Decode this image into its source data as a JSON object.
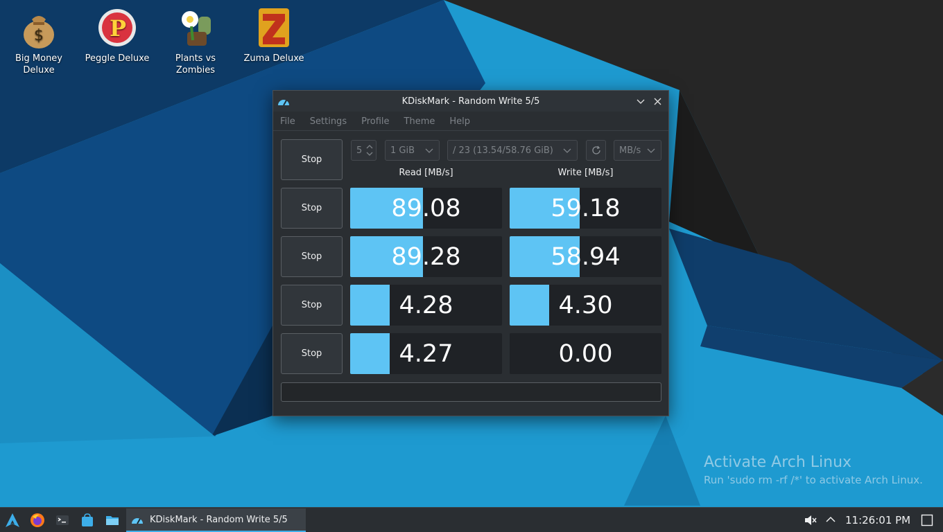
{
  "desktop": {
    "icons": [
      {
        "label": "Big Money\nDeluxe",
        "icon": "money-bag-icon"
      },
      {
        "label": "Peggle Deluxe",
        "icon": "peggle-icon"
      },
      {
        "label": "Plants vs\nZombies",
        "icon": "plants-vs-zombies-icon"
      },
      {
        "label": "Zuma Deluxe",
        "icon": "zuma-icon"
      }
    ],
    "watermark": {
      "title": "Activate Arch Linux",
      "subtitle": "Run 'sudo rm -rf /*' to activate Arch Linux."
    }
  },
  "window": {
    "title": "KDiskMark - Random Write 5/5",
    "menu": [
      "File",
      "Settings",
      "Profile",
      "Theme",
      "Help"
    ],
    "controls": {
      "runs": "5",
      "size": "1 GiB",
      "drive": "/ 23 (13.54/58.76 GiB)",
      "unit": "MB/s"
    },
    "headers": {
      "read": "Read [MB/s]",
      "write": "Write [MB/s]"
    },
    "all_button": "Stop",
    "rows": [
      {
        "button": "Stop",
        "read": "89.08",
        "write": "59.18",
        "read_fill": 0.48,
        "write_fill": 0.46
      },
      {
        "button": "Stop",
        "read": "89.28",
        "write": "58.94",
        "read_fill": 0.48,
        "write_fill": 0.46
      },
      {
        "button": "Stop",
        "read": "4.28",
        "write": "4.30",
        "read_fill": 0.26,
        "write_fill": 0.26
      },
      {
        "button": "Stop",
        "read": "4.27",
        "write": "0.00",
        "read_fill": 0.26,
        "write_fill": 0.0
      }
    ],
    "colors": {
      "bar": "#5ec4f4",
      "cell": "#1f2226"
    }
  },
  "taskbar": {
    "launchers": [
      "arch-linux-icon",
      "firefox-icon",
      "terminal-icon",
      "discover-store-icon",
      "file-manager-icon"
    ],
    "task": "KDiskMark - Random Write 5/5",
    "clock": "11:26:01 PM",
    "accent": "#3daee9"
  }
}
